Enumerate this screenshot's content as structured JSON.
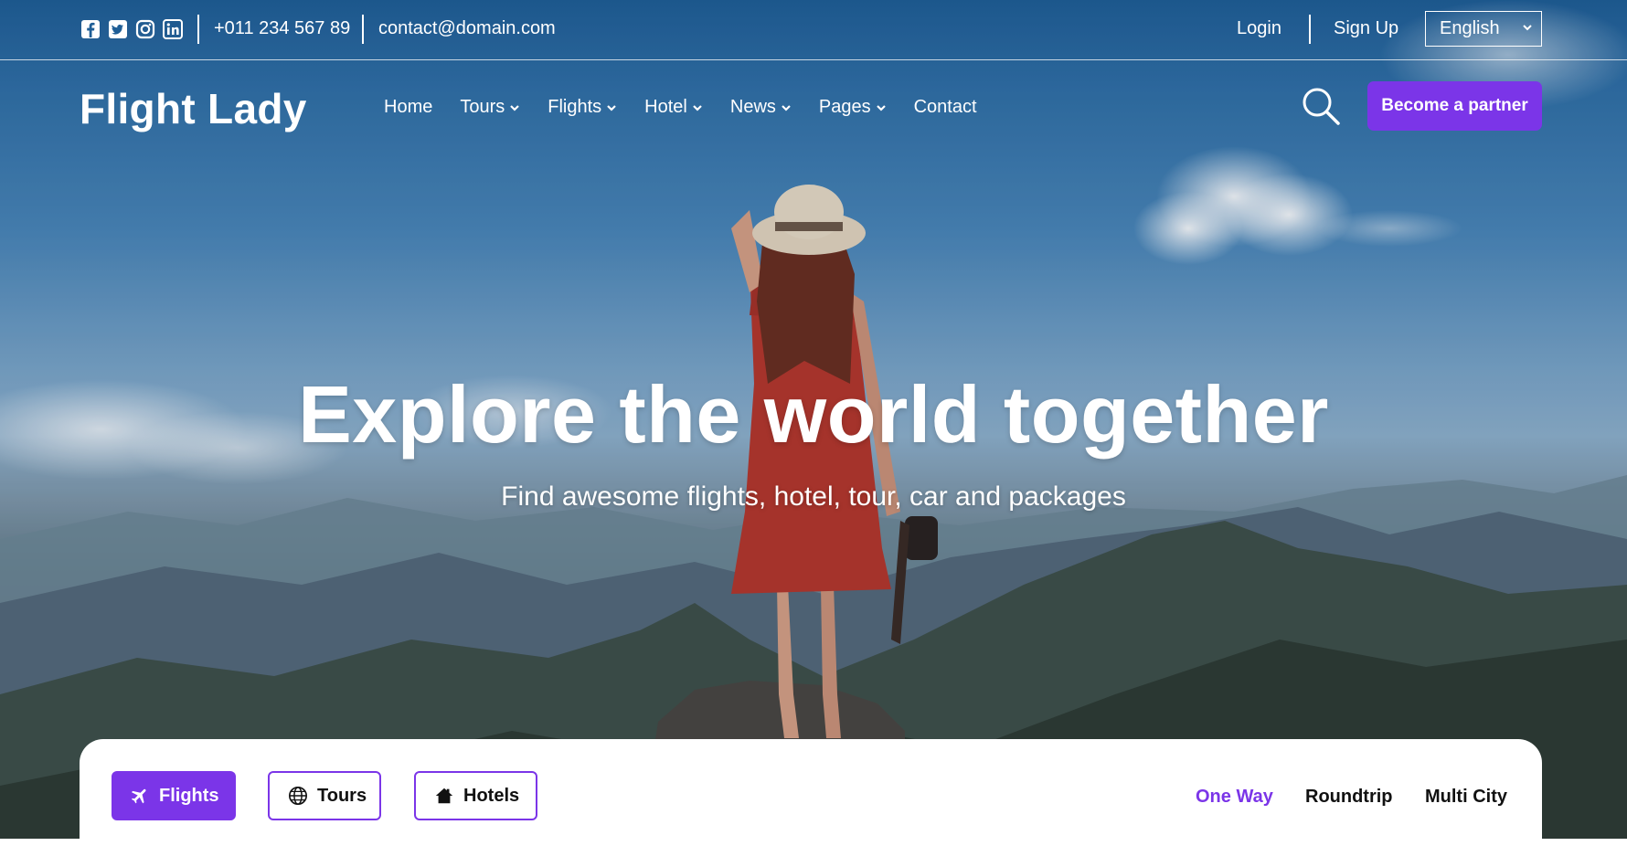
{
  "topbar": {
    "social_icons": [
      "facebook-icon",
      "twitter-icon",
      "instagram-icon",
      "linkedin-icon"
    ],
    "phone": "+011 234 567 89",
    "email": "contact@domain.com",
    "login": "Login",
    "signup": "Sign Up",
    "language": "English"
  },
  "header": {
    "brand": "Flight Lady",
    "nav": [
      "Home",
      "Tours",
      "Flights",
      "Hotel",
      "News",
      "Pages",
      "Contact"
    ],
    "partner_button": "Become a partner"
  },
  "hero": {
    "title": "Explore the world together",
    "subtitle": "Find awesome flights, hotel, tour, car and packages"
  },
  "search_panel": {
    "tabs": [
      {
        "label": "Flights",
        "icon": "plane-icon"
      },
      {
        "label": "Tours",
        "icon": "globe-icon"
      },
      {
        "label": "Hotels",
        "icon": "home-icon"
      }
    ],
    "trip_types": [
      "One Way",
      "Roundtrip",
      "Multi City"
    ],
    "active_trip": "One Way"
  },
  "colors": {
    "accent": "#7b35e8",
    "text_dark": "#111111",
    "white": "#ffffff"
  }
}
